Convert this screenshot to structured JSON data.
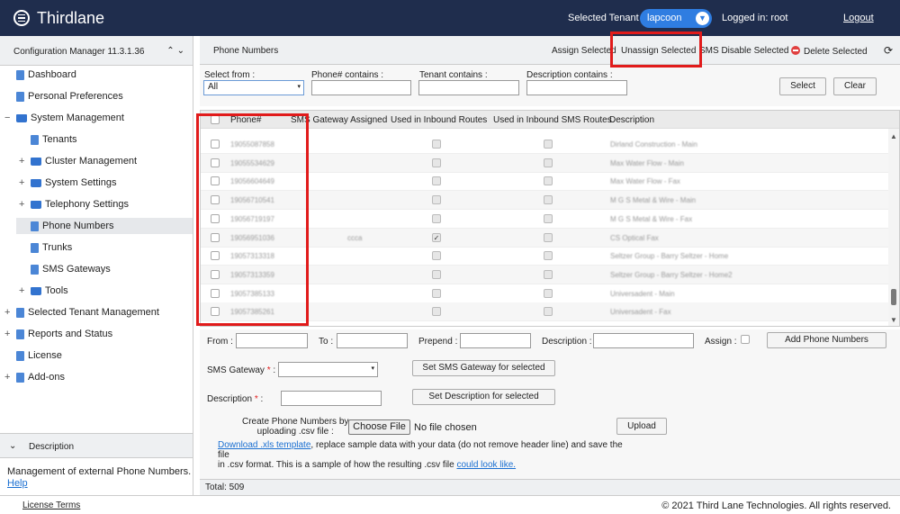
{
  "header": {
    "app_title": "Thirdlane",
    "tenant_label": "Selected Tenant :",
    "tenant_value": "lapcoon",
    "logged_in": "Logged in: root",
    "logout": "Logout"
  },
  "sidebar": {
    "title": "Configuration Manager 11.3.1.36",
    "items": [
      {
        "label": "Dashboard",
        "toggle": ""
      },
      {
        "label": "Personal Preferences",
        "toggle": ""
      },
      {
        "label": "System Management",
        "toggle": "−"
      },
      {
        "label": "Tenants",
        "toggle": ""
      },
      {
        "label": "Cluster Management",
        "toggle": "+"
      },
      {
        "label": "System Settings",
        "toggle": "+"
      },
      {
        "label": "Telephony Settings",
        "toggle": "+"
      },
      {
        "label": "Phone Numbers",
        "toggle": ""
      },
      {
        "label": "Trunks",
        "toggle": ""
      },
      {
        "label": "SMS Gateways",
        "toggle": ""
      },
      {
        "label": "Tools",
        "toggle": "+"
      },
      {
        "label": "Selected Tenant Management",
        "toggle": "+"
      },
      {
        "label": "Reports and Status",
        "toggle": "+"
      },
      {
        "label": "License",
        "toggle": ""
      },
      {
        "label": "Add-ons",
        "toggle": "+"
      }
    ],
    "description_title": "Description",
    "description_text": "Management of external Phone Numbers.",
    "help_link": "Help"
  },
  "main": {
    "title": "Phone Numbers",
    "actions": {
      "assign": "Assign Selected",
      "unassign": "Unassign Selected",
      "sms_disable": "SMS Disable Selected",
      "delete": "Delete Selected"
    },
    "filters": {
      "select_from_label": "Select from :",
      "select_from_value": "All",
      "phone_label": "Phone# contains :",
      "tenant_label": "Tenant contains :",
      "description_label": "Description contains :",
      "select_button": "Select",
      "clear_button": "Clear"
    },
    "grid": {
      "columns": [
        "Phone#",
        "SMS Gateway Assigned",
        "Used in Inbound Routes",
        "Used in Inbound SMS Routes",
        "Description"
      ],
      "rows": [
        {
          "phone": "19055087858",
          "sms": "",
          "inbound": false,
          "sms_inbound": false,
          "description": "Dirland Construction - Main"
        },
        {
          "phone": "19055534629",
          "sms": "",
          "inbound": false,
          "sms_inbound": false,
          "description": "Max Water Flow - Main"
        },
        {
          "phone": "19056604649",
          "sms": "",
          "inbound": false,
          "sms_inbound": false,
          "description": "Max Water Flow - Fax"
        },
        {
          "phone": "19056710541",
          "sms": "",
          "inbound": false,
          "sms_inbound": false,
          "description": "M G S Metal & Wire - Main"
        },
        {
          "phone": "19056719197",
          "sms": "",
          "inbound": false,
          "sms_inbound": false,
          "description": "M G S Metal & Wire - Fax"
        },
        {
          "phone": "19056951036",
          "sms": "ccca",
          "inbound": true,
          "sms_inbound": false,
          "description": "CS Optical Fax"
        },
        {
          "phone": "19057313318",
          "sms": "",
          "inbound": false,
          "sms_inbound": false,
          "description": "Seltzer Group - Barry Seltzer - Home"
        },
        {
          "phone": "19057313359",
          "sms": "",
          "inbound": false,
          "sms_inbound": false,
          "description": "Seltzer Group - Barry Seltzer - Home2"
        },
        {
          "phone": "19057385133",
          "sms": "",
          "inbound": false,
          "sms_inbound": false,
          "description": "Universadent - Main"
        },
        {
          "phone": "19057385261",
          "sms": "",
          "inbound": false,
          "sms_inbound": false,
          "description": "Universadent - Fax"
        }
      ]
    },
    "form": {
      "from_label": "From :",
      "to_label": "To :",
      "prepend_label": "Prepend :",
      "description_label": "Description :",
      "assign_label": "Assign :",
      "add_button": "Add Phone Numbers",
      "sms_gateway_label": "SMS Gateway",
      "set_sms_button": "Set SMS Gateway for selected",
      "desc_label": "Description",
      "set_desc_button": "Set Description for selected",
      "create_label_1": "Create Phone Numbers by",
      "create_label_2": "uploading .csv file :",
      "choose_file": "Choose File",
      "no_file": "No file chosen",
      "upload_button": "Upload",
      "download_link": "Download .xls template",
      "note_1": ", replace sample data with your data (do not remove header line) and save the file",
      "note_2": "in .csv format.  This is a sample of how the resulting .csv file",
      "look_link": "could look like."
    },
    "total": "Total: 509"
  },
  "footer": {
    "license_terms": "License Terms",
    "copyright": "© 2021 Third Lane Technologies. All rights reserved."
  }
}
